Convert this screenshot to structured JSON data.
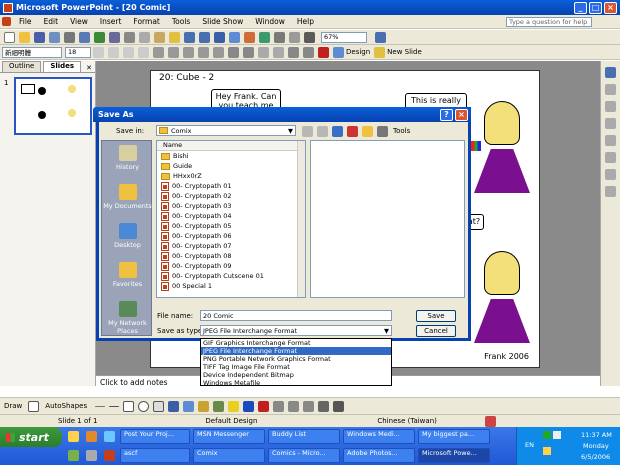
{
  "window": {
    "title": "Microsoft PowerPoint - [20 Comic]",
    "controls": [
      "_",
      "□",
      "×"
    ]
  },
  "menu": [
    "File",
    "Edit",
    "View",
    "Insert",
    "Format",
    "Tools",
    "Slide Show",
    "Window",
    "Help"
  ],
  "help_placeholder": "Type a question for help",
  "toolbar": {
    "zoom": "67%",
    "font": "新細明體",
    "size": "18",
    "design": "Design",
    "new_slide": "New Slide"
  },
  "panes": {
    "tab_outline": "Outline",
    "tab_slides": "Slides",
    "slide_number": "1"
  },
  "slide": {
    "title": "20: Cube - 2",
    "bubble1": "Hey Frank.  Can you teach me how",
    "bubble2": "This is really",
    "bubble3": "at?",
    "signature": "Frank 2006"
  },
  "dialog": {
    "title": "Save As",
    "save_in_label": "Save in:",
    "save_in_value": "Comix",
    "tools_label": "Tools",
    "column_name": "Name",
    "places": [
      "History",
      "My Documents",
      "Desktop",
      "Favorites",
      "My Network Places"
    ],
    "folders": [
      "Bishi",
      "Guide",
      "HHxx0rZ"
    ],
    "files": [
      "00- Cryptopath 01",
      "00- Cryptopath 02",
      "00- Cryptopath 03",
      "00- Cryptopath 04",
      "00- Cryptopath 05",
      "00- Cryptopath 06",
      "00- Cryptopath 07",
      "00- Cryptopath 08",
      "00- Cryptopath 09",
      "00- Cryptopath Cutscene 01",
      "00 Special 1"
    ],
    "filename_label": "File name:",
    "filename_value": "20 Comic",
    "savetype_label": "Save as type:",
    "savetype_value": "JPEG File Interchange Format",
    "save_button": "Save",
    "cancel_button": "Cancel",
    "type_options": [
      "GIF Graphics Interchange Format",
      "JPEG File Interchange Format",
      "PNG Portable Network Graphics Format",
      "TIFF Tag Image File Format",
      "Device Independent Bitmap",
      "Windows Metafile"
    ]
  },
  "notes_placeholder": "Click to add notes",
  "drawbar": {
    "draw": "Draw",
    "autoshapes": "AutoShapes"
  },
  "status": {
    "slide": "Slide 1 of 1",
    "design": "Default Design",
    "language": "Chinese (Taiwan)"
  },
  "taskbar": {
    "start": "start",
    "row1": [
      "Post Your Proj...",
      "MSN Messenger",
      "Buddy List",
      "Windows Medi...",
      "My biggest pa..."
    ],
    "row2": [
      "ascf",
      "Comix",
      "Comics - Micro...",
      "Adobe Photos...",
      "Microsoft Powe..."
    ],
    "lang": "EN",
    "time": "11:37 AM",
    "day": "Monday",
    "date": "6/5/2006"
  }
}
